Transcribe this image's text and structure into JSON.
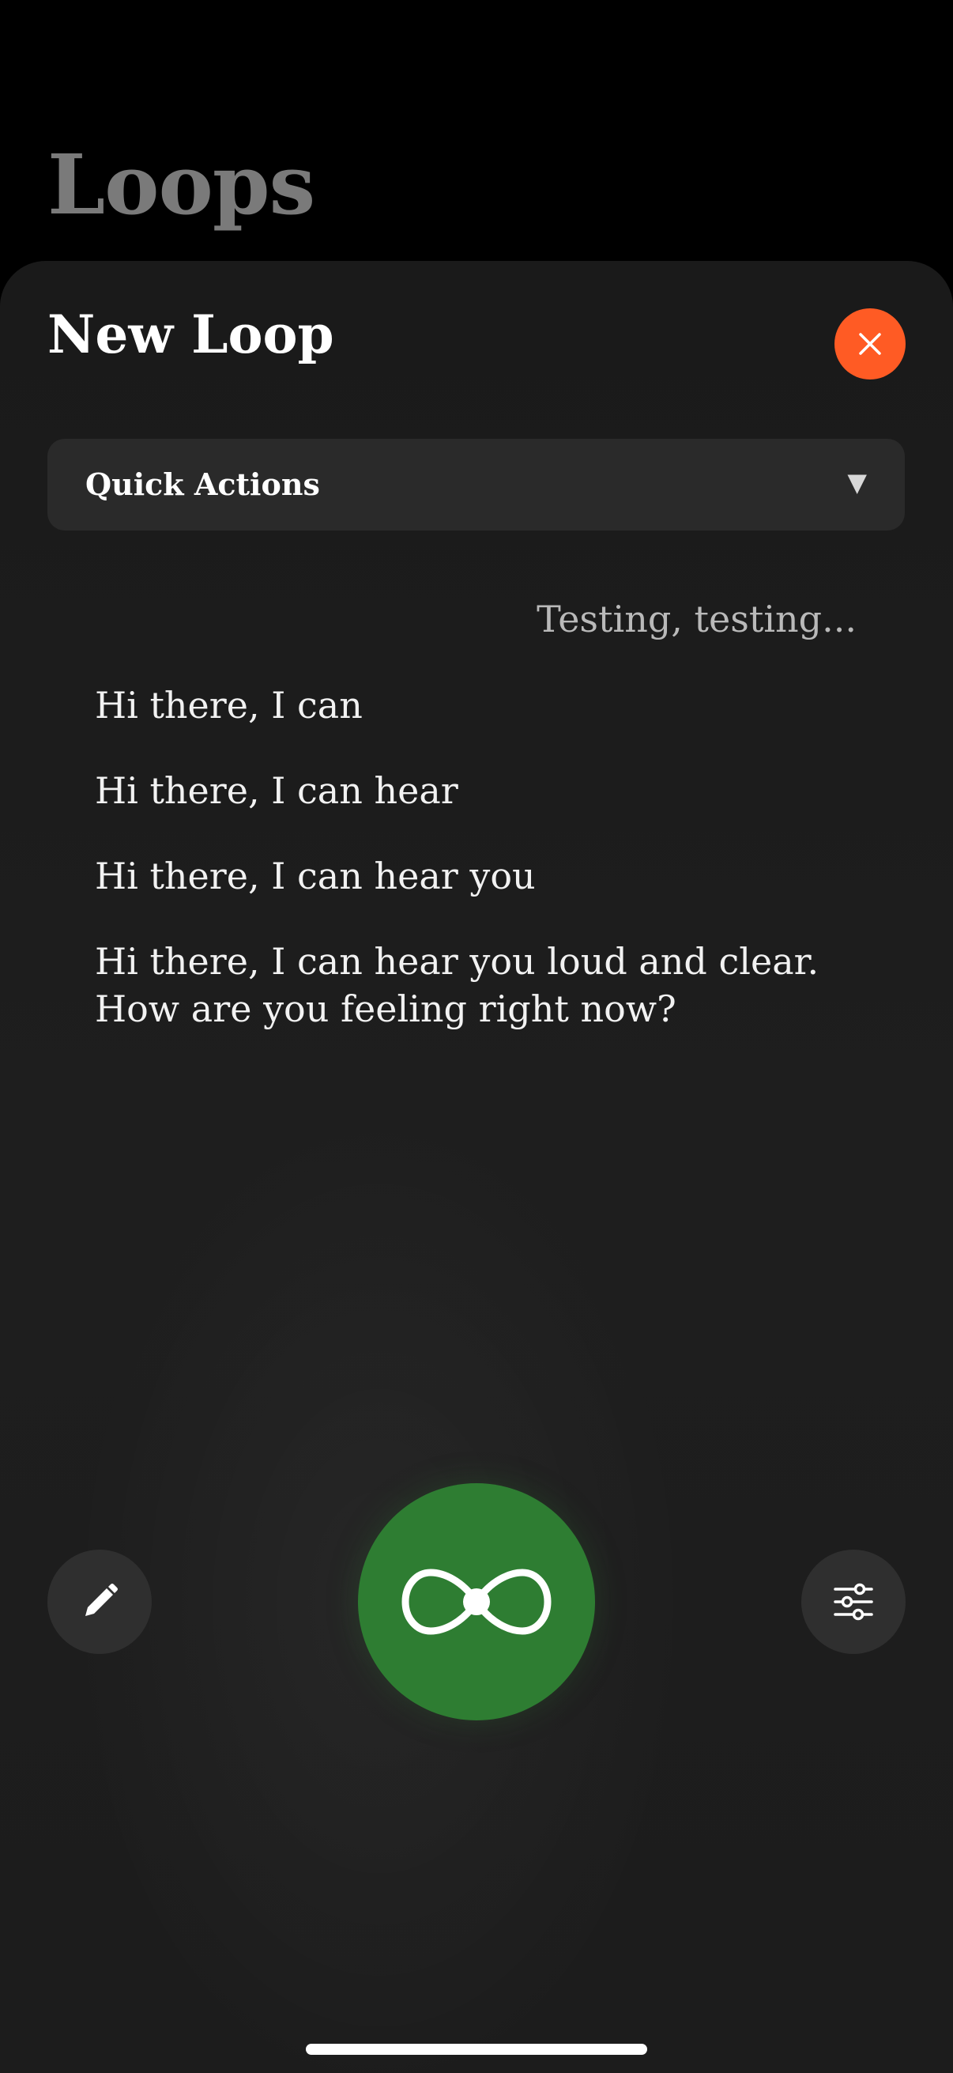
{
  "background": {
    "title": "Loops"
  },
  "sheet": {
    "title": "New Loop",
    "close_icon": "close-icon",
    "accent_color": "#ff5b24"
  },
  "quick_actions": {
    "label": "Quick Actions",
    "icon": "dropdown-triangle-icon"
  },
  "conversation": {
    "user_message": "Testing, testing...",
    "replies": [
      "Hi there, I can",
      "Hi there, I can hear",
      "Hi there, I can hear you",
      "Hi there, I can hear you loud and clear. How are you feeling right now?"
    ]
  },
  "toolbar": {
    "edit_icon": "pencil-icon",
    "main_icon": "loop-infinity-icon",
    "main_color": "#2e7d32",
    "settings_icon": "sliders-icon"
  }
}
